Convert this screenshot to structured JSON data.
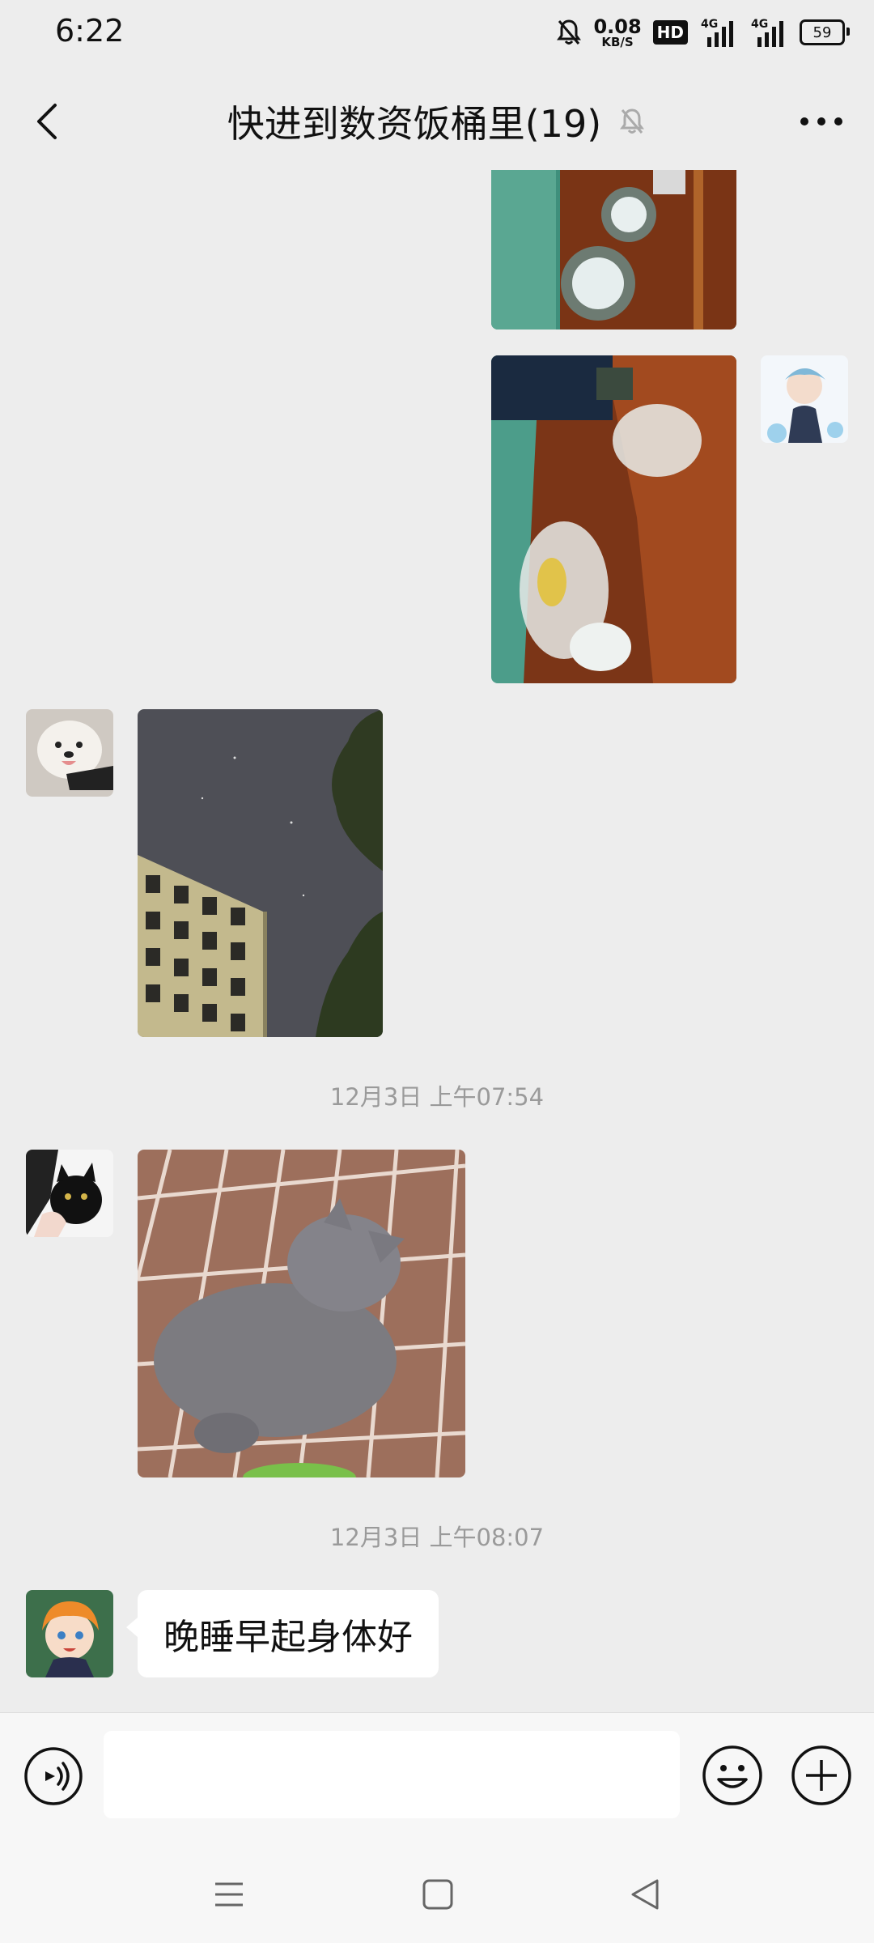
{
  "status_bar": {
    "time": "6:22",
    "net_speed_value": "0.08",
    "net_speed_unit": "KB/S",
    "hd_label": "HD",
    "signal1_label": "4G",
    "signal2_label": "4G",
    "battery": "59",
    "icons": [
      "mute-bell-icon",
      "signal-icon",
      "signal-icon",
      "battery-icon"
    ]
  },
  "header": {
    "title": "快进到数资饭桶里(19)",
    "icons": [
      "back-icon",
      "muted-bell-icon",
      "more-icon"
    ]
  },
  "messages": {
    "ts1": "12月3日 上午07:54",
    "ts2": "12月3日 上午08:07",
    "text1": "晚睡早起身体好"
  },
  "input_bar": {
    "placeholder": "",
    "icons": [
      "voice-icon",
      "emoji-icon",
      "plus-icon"
    ]
  },
  "nav_bar": {
    "icons": [
      "menu-icon",
      "home-icon",
      "back-triangle-icon"
    ]
  },
  "colors": {
    "background": "#EDEDED",
    "bubble": "#FFFFFF",
    "timestamp": "#9A9A9A",
    "bar": "#F7F7F7"
  }
}
